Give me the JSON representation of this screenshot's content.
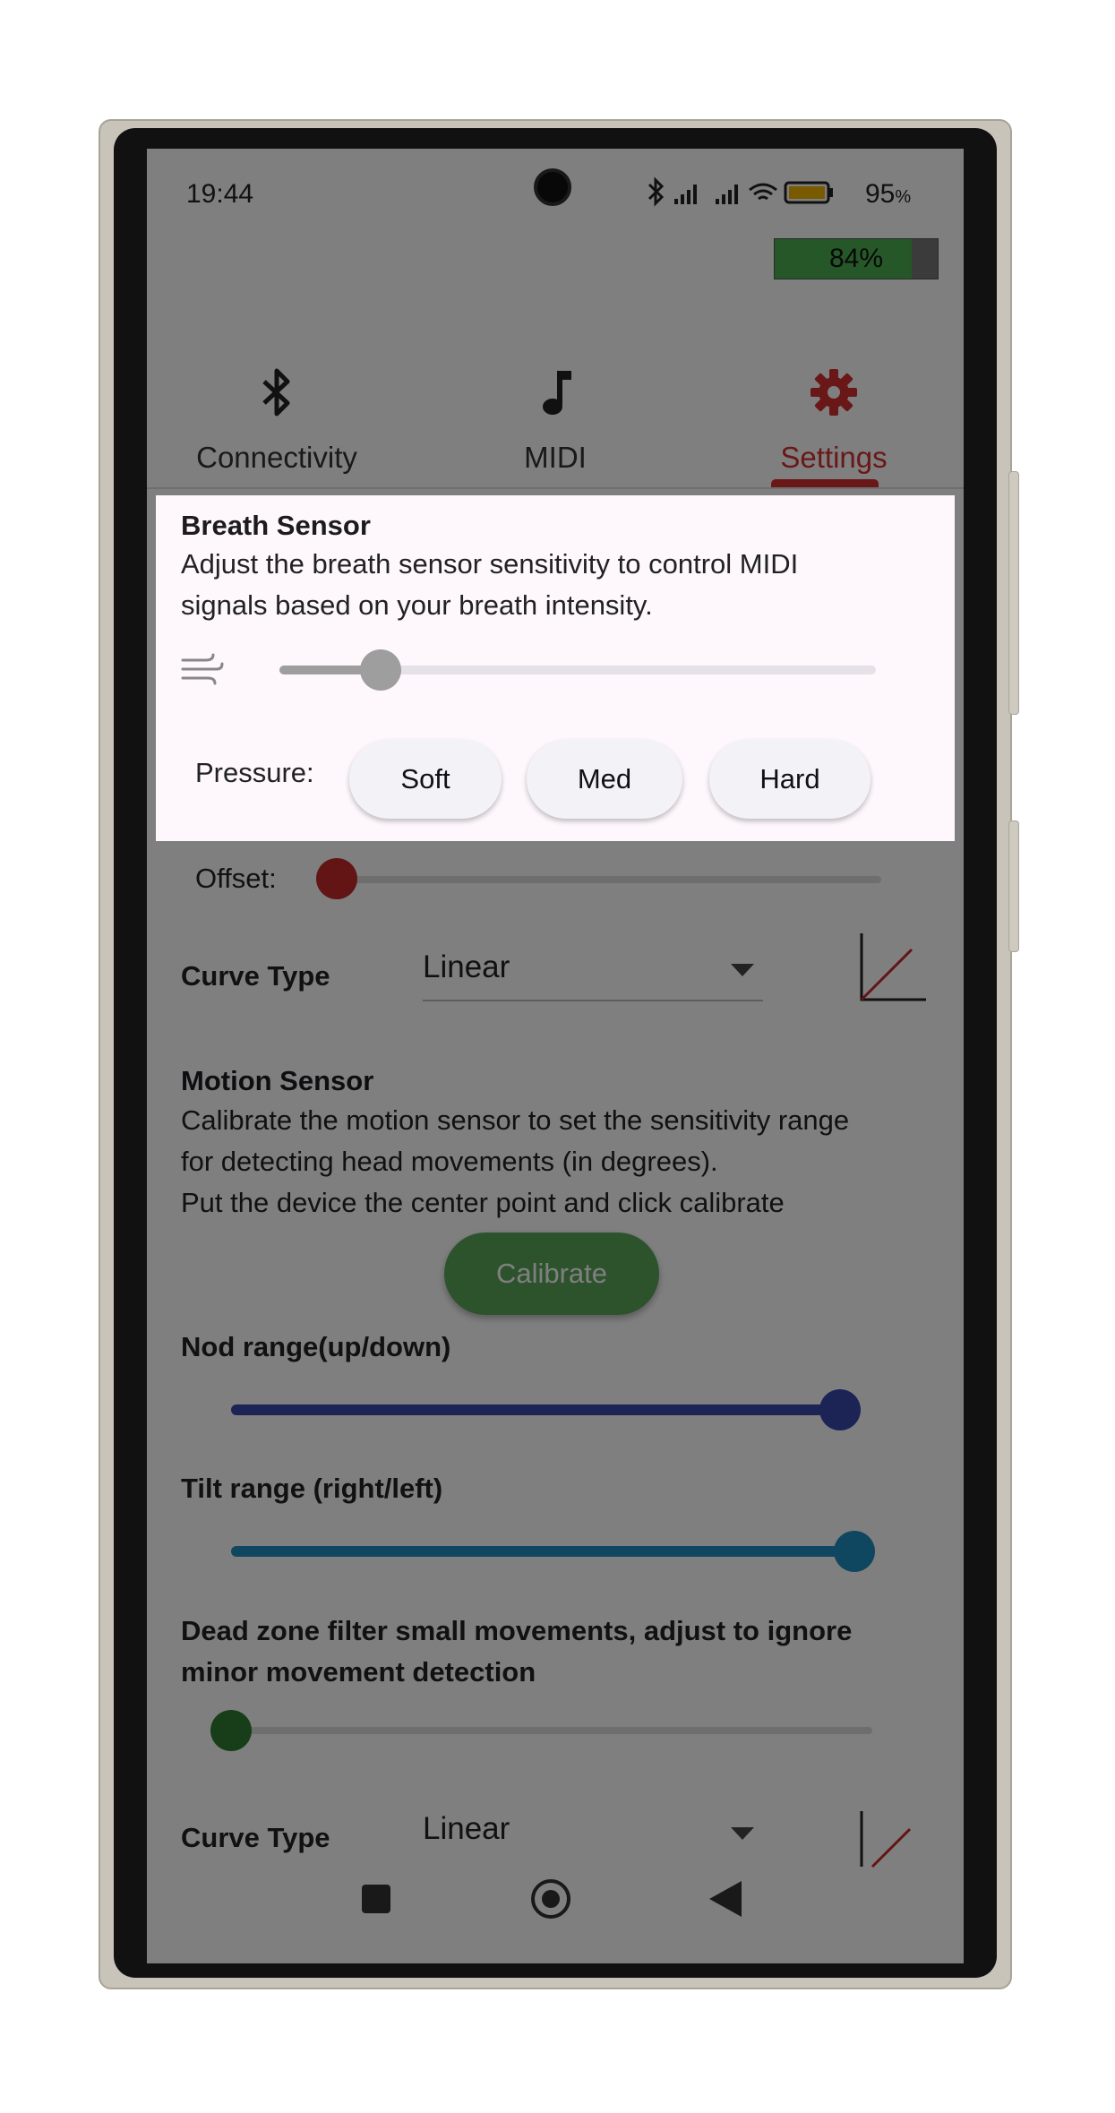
{
  "status_bar": {
    "time": "19:44",
    "battery_percent": "95",
    "battery_unit": "%"
  },
  "device_battery": {
    "label": "84%",
    "level": 0.84,
    "color": "#4caf50"
  },
  "tabs": [
    {
      "label": "Connectivity",
      "icon": "bluetooth-icon",
      "selected": false
    },
    {
      "label": "MIDI",
      "icon": "music-note-icon",
      "selected": false
    },
    {
      "label": "Settings",
      "icon": "gear-icon",
      "selected": true
    }
  ],
  "accent_color": "#d2302e",
  "breath_sensor": {
    "title": "Breath Sensor",
    "description_line1": "Adjust the breath sensor sensitivity to control MIDI",
    "description_line2": "signals based on your breath intensity.",
    "icon": "wind-icon",
    "slider_value": 0.17,
    "pressure_label": "Pressure:",
    "pressure_options": [
      "Soft",
      "Med",
      "Hard"
    ]
  },
  "offset": {
    "label": "Offset:",
    "value": 0.0,
    "color": "#c62828"
  },
  "curve_type_1": {
    "label": "Curve Type",
    "value": "Linear"
  },
  "motion_sensor": {
    "title": "Motion Sensor",
    "description_line1": "Calibrate the motion sensor to set the sensitivity range",
    "description_line2": "for detecting head movements (in degrees).",
    "description_line3": "Put the device the center point and click calibrate",
    "calibrate_label": "Calibrate"
  },
  "nod_range": {
    "label": "Nod range(up/down)",
    "value": 1.0,
    "color": "#3949ab"
  },
  "tilt_range": {
    "label": "Tilt range (right/left)",
    "value": 1.0,
    "color": "#1f8fc2"
  },
  "dead_zone": {
    "label_line1": "Dead zone filter small movements, adjust to ignore",
    "label_line2": "minor movement detection",
    "value": 0.0,
    "color": "#2e7d32"
  },
  "curve_type_2": {
    "label": "Curve Type",
    "value": "Linear"
  },
  "nav_bar": [
    "recents-square-icon",
    "home-circle-icon",
    "back-triangle-icon"
  ]
}
